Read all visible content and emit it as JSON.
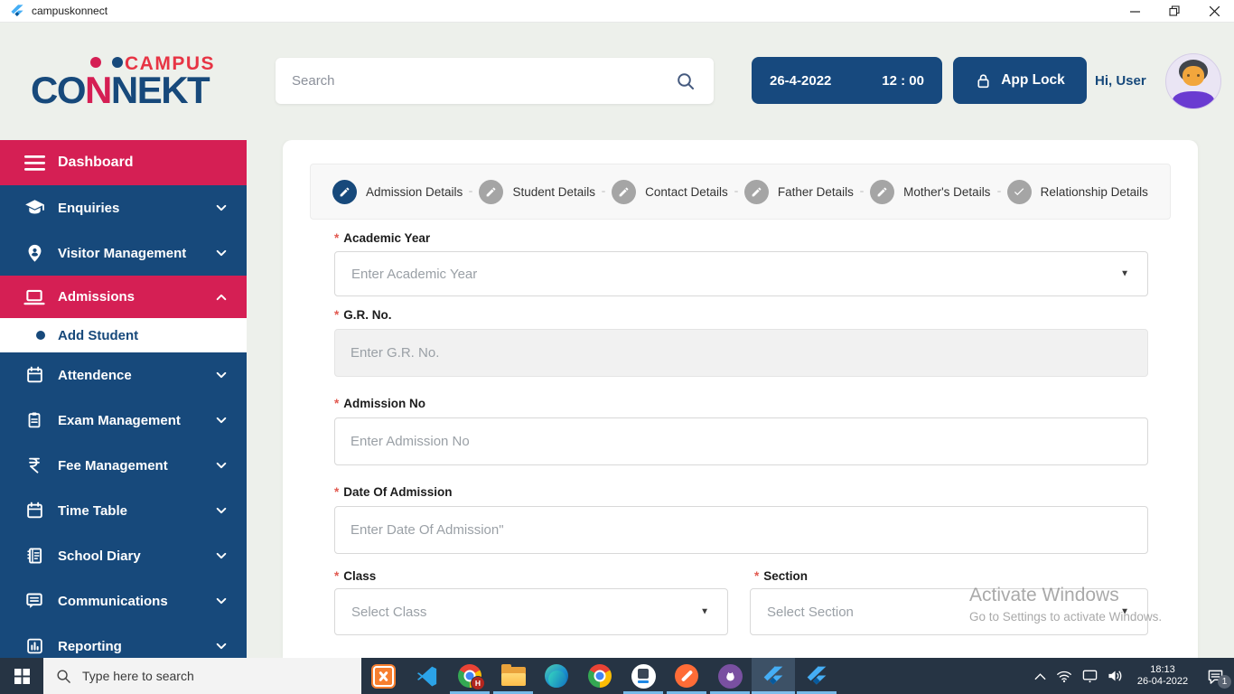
{
  "window": {
    "title": "campuskonnect"
  },
  "header": {
    "logo": {
      "top_word": "CAMPUS",
      "main_word_parts": [
        "CO",
        "N",
        "N",
        "EKT"
      ]
    },
    "search": {
      "placeholder": "Search"
    },
    "datetime": {
      "date": "26-4-2022",
      "time": "12 : 00"
    },
    "app_lock": {
      "label": "App Lock"
    },
    "greeting": "Hi, User"
  },
  "sidebar": {
    "items": [
      {
        "label": "Dashboard"
      },
      {
        "label": "Enquiries"
      },
      {
        "label": "Visitor Management"
      },
      {
        "label": "Admissions"
      },
      {
        "label": "Add Student"
      },
      {
        "label": "Attendence"
      },
      {
        "label": "Exam Management"
      },
      {
        "label": "Fee Management"
      },
      {
        "label": "Time Table"
      },
      {
        "label": "School Diary"
      },
      {
        "label": "Communications"
      },
      {
        "label": "Reporting"
      }
    ]
  },
  "wizard": {
    "steps": [
      {
        "label": "Admission Details",
        "icon": "pencil-icon",
        "active": true
      },
      {
        "label": "Student Details",
        "icon": "pencil-icon",
        "active": false
      },
      {
        "label": "Contact Details",
        "icon": "pencil-icon",
        "active": false
      },
      {
        "label": "Father Details",
        "icon": "pencil-icon",
        "active": false
      },
      {
        "label": "Mother's Details",
        "icon": "pencil-icon",
        "active": false
      },
      {
        "label": "Relationship Details",
        "icon": "check-icon",
        "active": false
      }
    ]
  },
  "form": {
    "required_marker": "*",
    "fields": [
      {
        "label": "Academic Year",
        "placeholder": "Enter Academic Year",
        "type": "select"
      },
      {
        "label": "G.R. No.",
        "placeholder": "Enter G.R. No.",
        "type": "text",
        "disabled": true
      },
      {
        "label": "Admission No",
        "placeholder": "Enter Admission No",
        "type": "text"
      },
      {
        "label": "Date Of Admission",
        "placeholder": "Enter Date Of Admission\"",
        "type": "text"
      },
      {
        "label": "Class",
        "placeholder": "Select Class",
        "type": "select"
      },
      {
        "label": "Section",
        "placeholder": "Select Section",
        "type": "select"
      }
    ]
  },
  "watermark": {
    "line1": "Activate Windows",
    "line2": "Go to Settings to activate Windows."
  },
  "taskbar": {
    "search": {
      "placeholder": "Type here to search"
    },
    "apps": [
      "xampp",
      "vscode",
      "chrome-profile-h",
      "file-explorer",
      "edge",
      "chrome",
      "android-app",
      "postman",
      "github-desktop",
      "flutter-active",
      "flutter"
    ],
    "chrome_badge": "H",
    "clock": {
      "time": "18:13",
      "date": "26-04-2022"
    },
    "notification_badge": "1"
  },
  "colors": {
    "accent_pink": "#D51F54",
    "accent_blue": "#17497B",
    "header_bg": "#EDF0EB",
    "taskbar_bg": "#263444"
  }
}
